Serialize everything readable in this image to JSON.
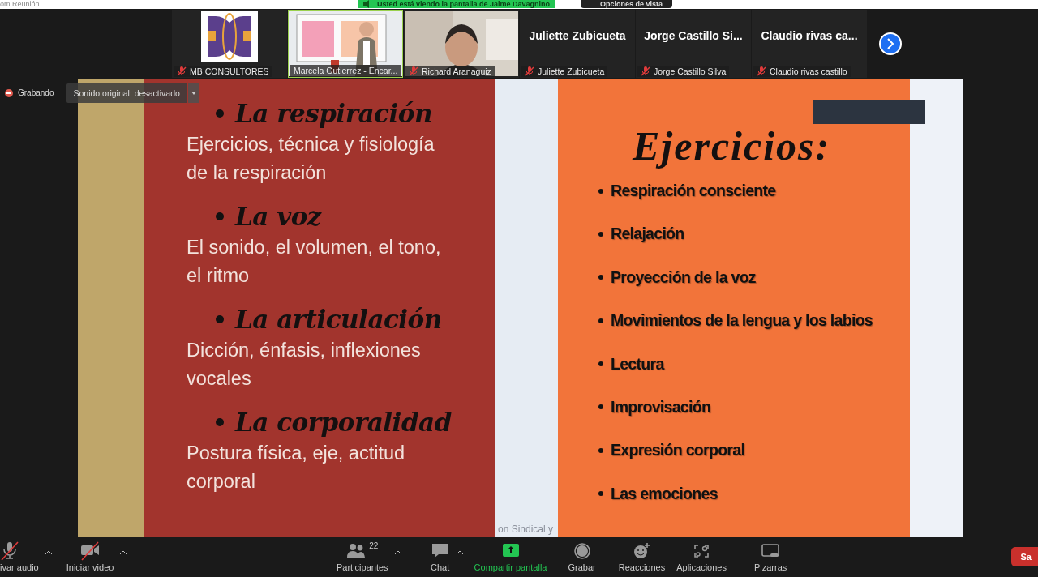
{
  "top_bar": {
    "app_title": "om Reunión",
    "share_banner": "Usted está viendo la pantalla de Jaime Davagnino",
    "view_options": "Opciones de vista"
  },
  "gallery": [
    {
      "kind": "logo",
      "label": "MB CONSULTORES",
      "muted": true
    },
    {
      "kind": "video",
      "label": "Marcela Gutierrez - Encar...",
      "muted": false,
      "speaking": true
    },
    {
      "kind": "video",
      "label": "Richard Aranaguiz",
      "muted": true,
      "speaking": false
    },
    {
      "kind": "name",
      "display_name": "Juliette Zubicueta",
      "label": "Juliette Zubicueta",
      "muted": true
    },
    {
      "kind": "name",
      "display_name": "Jorge Castillo Si...",
      "label": "Jorge Castillo Silva",
      "muted": true
    },
    {
      "kind": "name",
      "display_name": "Claudio rivas ca...",
      "label": "Claudio rivas castillo",
      "muted": true
    }
  ],
  "recording": {
    "label": "Grabando",
    "sound_option": "Sonido original: desactivado"
  },
  "slide": {
    "sections": [
      {
        "heading": "La respiración",
        "body": "Ejercicios, técnica y fisiología de la respiración"
      },
      {
        "heading": "La voz",
        "body": "El sonido, el volumen, el tono, el ritmo"
      },
      {
        "heading": "La articulación",
        "body": "Dicción, énfasis, inflexiones vocales"
      },
      {
        "heading": "La corporalidad",
        "body": "Postura física, eje, actitud corporal"
      }
    ],
    "exercises_title": "Ejercicios:",
    "exercises": [
      "Respiración consciente",
      "Relajación",
      "Proyección de la voz",
      "Movimientos de la lengua y los labios",
      "Lectura",
      "Improvisación",
      "Expresión corporal",
      "Las emociones"
    ],
    "footer": "on Sindical y"
  },
  "toolbar": [
    {
      "kind": "audio",
      "label": "ivar audio",
      "off": true,
      "caret": true
    },
    {
      "kind": "video",
      "label": "Iniciar video",
      "off": true,
      "caret": true
    },
    {
      "kind": "participants",
      "label": "Participantes",
      "count": "22",
      "caret": true
    },
    {
      "kind": "chat",
      "label": "Chat",
      "caret": true
    },
    {
      "kind": "share",
      "label": "Compartir pantalla"
    },
    {
      "kind": "record",
      "label": "Grabar"
    },
    {
      "kind": "reactions",
      "label": "Reacciones"
    },
    {
      "kind": "apps",
      "label": "Aplicaciones"
    },
    {
      "kind": "whiteboard",
      "label": "Pizarras"
    }
  ],
  "leave_button": "Sa"
}
